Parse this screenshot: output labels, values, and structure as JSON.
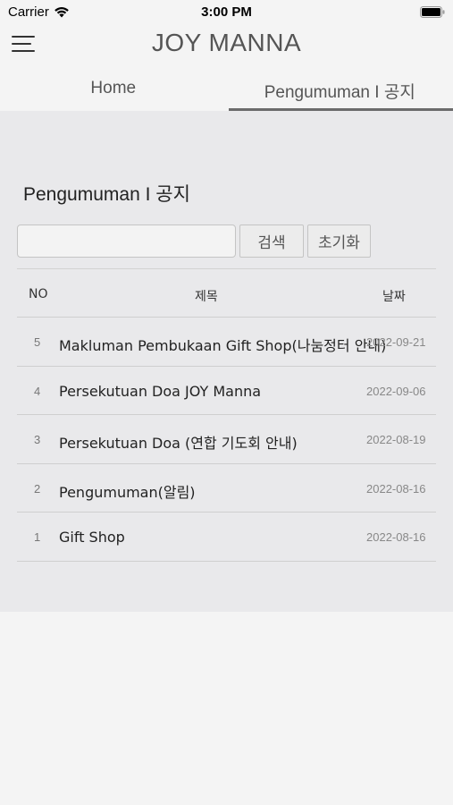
{
  "status_bar": {
    "carrier": "Carrier",
    "time": "3:00 PM",
    "icons": [
      "wifi-icon",
      "battery-icon"
    ]
  },
  "header": {
    "title": "JOY MANNA",
    "menu_icon": "hamburger-menu-icon"
  },
  "tabs": [
    {
      "label": "Home",
      "active": false
    },
    {
      "label": "Pengumuman I 공지",
      "active": true
    }
  ],
  "page": {
    "heading": "Pengumuman I 공지"
  },
  "search": {
    "placeholder": "",
    "value": "",
    "search_button": "검색",
    "reset_button": "초기화"
  },
  "table": {
    "columns": {
      "no": "NO",
      "title": "제목",
      "date": "날짜"
    },
    "rows": [
      {
        "no": "5",
        "title": "Makluman Pembukaan Gift Shop(나눔정터 안내)",
        "date": "2022-09-21"
      },
      {
        "no": "4",
        "title": "Persekutuan Doa JOY Manna",
        "date": "2022-09-06"
      },
      {
        "no": "3",
        "title": "Persekutuan Doa (연합 기도회 안내)",
        "date": "2022-08-19"
      },
      {
        "no": "2",
        "title": "Pengumuman(알림)",
        "date": "2022-08-16"
      },
      {
        "no": "1",
        "title": "Gift Shop",
        "date": "2022-08-16"
      }
    ]
  },
  "colors": {
    "background": "#f4f4f4",
    "content_background": "#e9e9eb",
    "tab_underline": "#6b6b6b"
  }
}
